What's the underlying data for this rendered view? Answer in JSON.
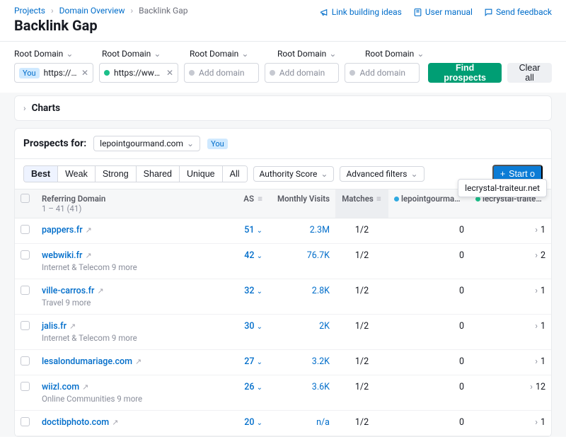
{
  "breadcrumbs": [
    "Projects",
    "Domain Overview",
    "Backlink Gap"
  ],
  "title": "Backlink Gap",
  "header_links": {
    "ideas": "Link building ideas",
    "manual": "User manual",
    "feedback": "Send feedback"
  },
  "root_domain_label": "Root Domain",
  "you_badge": "You",
  "inputs": [
    {
      "value": "https://lep…",
      "is_you": true
    },
    {
      "value": "https://www.l…",
      "dot": "#1bbf89"
    },
    {
      "placeholder": "Add domain"
    },
    {
      "placeholder": "Add domain"
    },
    {
      "placeholder": "Add domain"
    }
  ],
  "find_button": "Find prospects",
  "clear_button": "Clear all",
  "charts_label": "Charts",
  "prospects_for_label": "Prospects for:",
  "prospects_for_value": "lepointgourmand.com",
  "tabs": [
    "Best",
    "Weak",
    "Strong",
    "Shared",
    "Unique",
    "All"
  ],
  "active_tab": 0,
  "authority_score_label": "Authority Score",
  "advanced_filters_label": "Advanced filters",
  "start_button": "Start o",
  "tooltip_text": "lecrystal-traiteur.net",
  "columns": {
    "domain": "Referring Domain",
    "domain_sub": "1 – 41 (41)",
    "as": "AS",
    "visits": "Monthly Visits",
    "matches": "Matches",
    "comp1": "lepointgourman…",
    "comp2": "lecrystal-traiteu…"
  },
  "rows": [
    {
      "domain": "pappers.fr",
      "sub": "",
      "as": 51,
      "visits": "2.3M",
      "matches": "1/2",
      "c1": 0,
      "c2": 1
    },
    {
      "domain": "webwiki.fr",
      "sub": "Internet & Telecom 9 more",
      "as": 42,
      "visits": "76.7K",
      "matches": "1/2",
      "c1": 0,
      "c2": 2
    },
    {
      "domain": "ville-carros.fr",
      "sub": "Travel 9 more",
      "as": 32,
      "visits": "2.8K",
      "matches": "1/2",
      "c1": 0,
      "c2": 1
    },
    {
      "domain": "jalis.fr",
      "sub": "Internet & Telecom 9 more",
      "as": 30,
      "visits": "2K",
      "matches": "1/2",
      "c1": 0,
      "c2": 1
    },
    {
      "domain": "lesalondumariage.com",
      "sub": "",
      "as": 27,
      "visits": "3.2K",
      "matches": "1/2",
      "c1": 0,
      "c2": 1
    },
    {
      "domain": "wiizl.com",
      "sub": "Online Communities 9 more",
      "as": 26,
      "visits": "3.6K",
      "matches": "1/2",
      "c1": 0,
      "c2": 12
    },
    {
      "domain": "doctibphoto.com",
      "sub": "",
      "as": 20,
      "visits": "n/a",
      "matches": "1/2",
      "c1": 0,
      "c2": 1
    }
  ]
}
